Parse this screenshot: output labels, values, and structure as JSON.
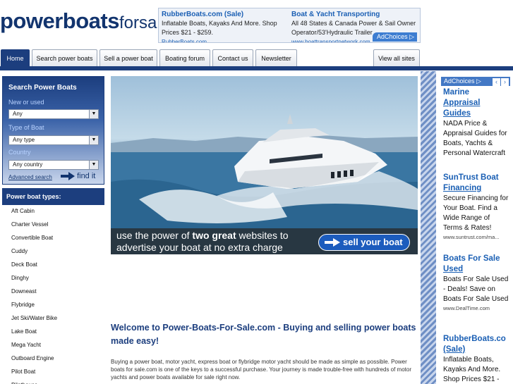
{
  "header": {
    "logo_bold": "powerboats",
    "logo_light": "forsale"
  },
  "top_ad": {
    "ads": [
      {
        "title": "RubberBoats.com (Sale)",
        "lines": [
          "Inflatable Boats, Kayaks And More. Shop",
          "Prices $21 - $259."
        ],
        "url": "RubberBoats.com"
      },
      {
        "title": "Boat & Yacht Transporting",
        "lines": [
          "All 48 States & Canada Power & Sail Owner",
          "Operator/53'Hydraulic Trailer"
        ],
        "url": "www.boattransportnetwork.com"
      }
    ],
    "adchoices": "AdChoices ▷"
  },
  "nav": {
    "tabs": [
      {
        "label": "Home",
        "active": true
      },
      {
        "label": "Search power boats"
      },
      {
        "label": "Sell a power boat"
      },
      {
        "label": "Boating forum"
      },
      {
        "label": "Contact us"
      },
      {
        "label": "Newsletter"
      },
      {
        "label": "View all sites"
      }
    ]
  },
  "search": {
    "title": "Search Power Boats",
    "new_or_used_label": "New or used",
    "new_or_used_value": "Any",
    "type_label": "Type of Boat",
    "type_value": "Any type",
    "country_label": "Country",
    "country_value": "Any country",
    "advanced_link": "Advanced search",
    "find_label": "find it"
  },
  "boat_types": {
    "header": "Power boat types:",
    "items": [
      "Aft Cabin",
      "Charter Vessel",
      "Convertible Boat",
      "Cuddy",
      "Deck Boat",
      "Dinghy",
      "Downeast",
      "Flybridge",
      "Jet Ski/Water Bike",
      "Lake Boat",
      "Mega Yacht",
      "Outboard Engine",
      "Pilot Boat",
      "Pilothouse"
    ]
  },
  "banner": {
    "line1_pre": "use the power of ",
    "line1_bold": "two great",
    "line1_post": " websites to",
    "line2": "advertise your boat at no extra charge",
    "button": "sell your boat"
  },
  "welcome": {
    "title": "Welcome to Power-Boats-For-Sale.com - Buying and selling power boats made easy!",
    "text": "Buying a power boat, motor yacht, express boat or flybridge motor yacht should be made as simple as possible. Power boats for sale.com is one of the keys to a successful purchase. Your journey is made trouble-free with hundreds of motor yachts and power boats available for sale right now."
  },
  "right_ad": {
    "adchoices": "AdChoices ▷",
    "ads": [
      {
        "title": "Marine",
        "title2": "Appraisal Guides",
        "desc": "NADA Price & Appraisal Guides for Boats, Yachts & Personal Watercraft",
        "url": ""
      },
      {
        "title": "SunTrust Boat",
        "title2": "Financing",
        "desc": "Secure Financing for Your Boat. Find a Wide Range of Terms & Rates!",
        "url": "www.suntrust.com/ma..."
      },
      {
        "title": "Boats For Sale",
        "title2": "Used",
        "desc": "Boats For Sale Used - Deals! Save on Boats For Sale Used",
        "url": "www.DealTime.com"
      },
      {
        "title": "RubberBoats.co",
        "title2": "(Sale)",
        "desc": "Inflatable Boats, Kayaks And More. Shop Prices $21 -",
        "url": ""
      }
    ]
  },
  "colors": {
    "brand_navy": "#1c3e7e",
    "link_blue": "#1a5fb4",
    "banner_button": "#1c5cbd"
  }
}
